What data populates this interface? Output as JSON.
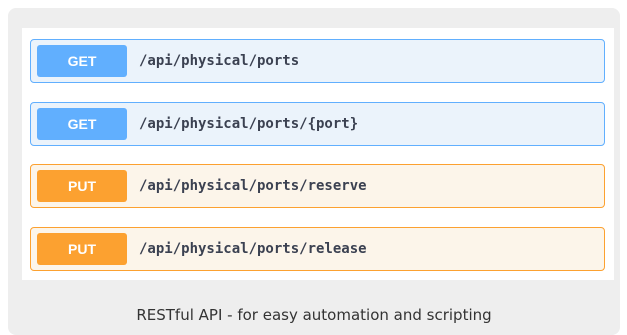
{
  "endpoints": [
    {
      "method": "GET",
      "path": "/api/physical/ports"
    },
    {
      "method": "GET",
      "path": "/api/physical/ports/{port}"
    },
    {
      "method": "PUT",
      "path": "/api/physical/ports/reserve"
    },
    {
      "method": "PUT",
      "path": "/api/physical/ports/release"
    }
  ],
  "caption": "RESTful API - for easy automation and scripting",
  "colors": {
    "get": "#61affe",
    "get_background": "#ebf3fb",
    "put": "#fca130",
    "put_background": "#fcf5ea",
    "frame_background": "#eeeeee",
    "path_text": "#3b4151"
  }
}
